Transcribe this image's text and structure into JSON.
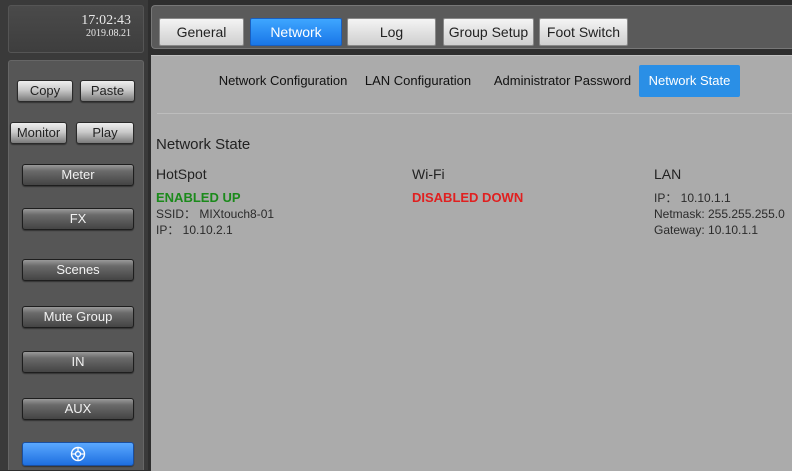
{
  "clock": {
    "time": "17:02:43",
    "date": "2019.08.21"
  },
  "sidebar": {
    "copy": "Copy",
    "paste": "Paste",
    "monitor": "Monitor",
    "play": "Play",
    "meter": "Meter",
    "fx": "FX",
    "scenes": "Scenes",
    "mute_group": "Mute Group",
    "in": "IN",
    "aux": "AUX",
    "bottom_icon": "settings-dial-icon"
  },
  "tabs": {
    "general": "General",
    "network": "Network",
    "log": "Log",
    "group_setup": "Group Setup",
    "foot_switch": "Foot Switch",
    "active": "Network"
  },
  "subtabs": {
    "network_configuration": "Network Configuration",
    "lan_configuration": "LAN Configuration",
    "administrator_password": "Administrator Password",
    "network_state": "Network State",
    "active": "Network State"
  },
  "network_state": {
    "title": "Network State",
    "hotspot": {
      "label": "HotSpot",
      "status": "ENABLED UP",
      "ssid": "SSID： MIXtouch8-01",
      "ip": "IP： 10.10.2.1"
    },
    "wifi": {
      "label": "Wi-Fi",
      "status": "DISABLED DOWN"
    },
    "lan": {
      "label": "LAN",
      "ip": "IP： 10.10.1.1",
      "netmask": "Netmask: 255.255.255.0",
      "gateway": "Gateway: 10.10.1.1"
    }
  },
  "colors": {
    "active_blue": "#2a8fe6",
    "status_up": "#1b8a1b",
    "status_down": "#e02020"
  }
}
